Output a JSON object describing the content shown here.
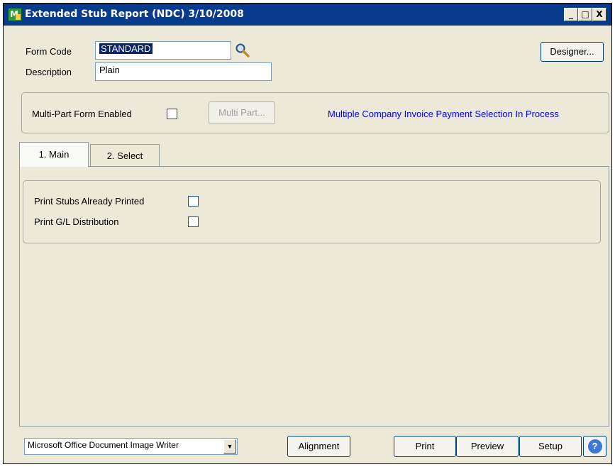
{
  "window": {
    "title": "Extended Stub Report (NDC) 3/10/2008",
    "app_icon_letter": "M",
    "minimize": "_",
    "maximize": "□",
    "close": "X"
  },
  "form": {
    "form_code_label": "Form Code",
    "form_code_value": "STANDARD",
    "description_label": "Description",
    "description_value": "Plain",
    "designer_label": "Designer..."
  },
  "multipart": {
    "label": "Multi-Part Form Enabled",
    "checked": false,
    "button_label": "Multi Part...",
    "status_message": "Multiple Company Invoice Payment Selection In Process",
    "status_color": "#0000ff"
  },
  "tabs": [
    {
      "label": "1. Main",
      "active": true
    },
    {
      "label": "2. Select",
      "active": false
    }
  ],
  "main_tab": {
    "options": [
      {
        "label": "Print Stubs Already Printed",
        "checked": false
      },
      {
        "label": "Print G/L Distribution",
        "checked": false
      }
    ]
  },
  "footer": {
    "printer_value": "Microsoft Office Document Image Writer",
    "alignment_label": "Alignment",
    "print_label": "Print",
    "preview_label": "Preview",
    "setup_label": "Setup",
    "help_icon_glyph": "?"
  },
  "colors": {
    "titlebar": "#083b8c",
    "window_bg": "#ece9d8",
    "selection": "#0a246a"
  }
}
